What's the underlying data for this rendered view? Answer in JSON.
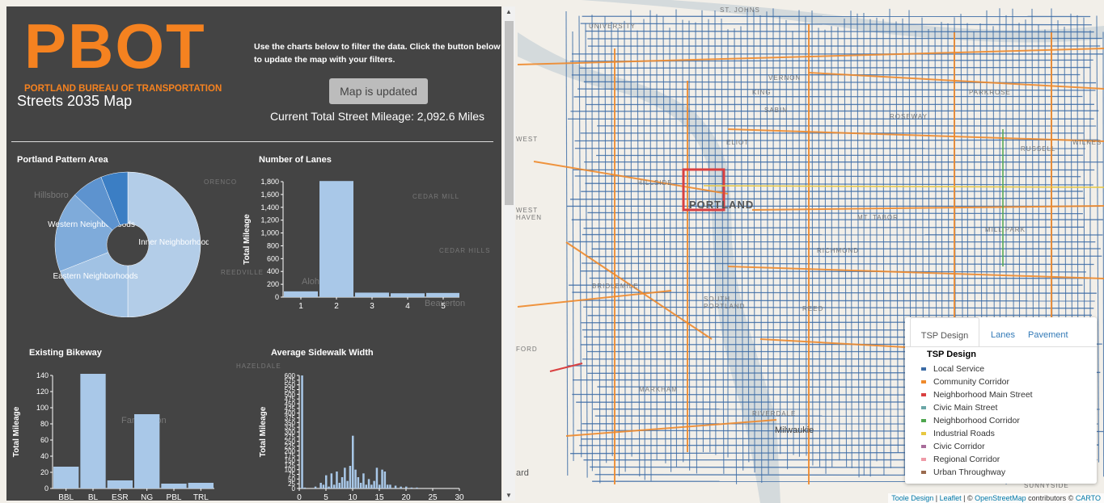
{
  "logo": {
    "text": "PBOT",
    "subtitle": "PORTLAND BUREAU OF TRANSPORTATION"
  },
  "panel": {
    "map_title": "Streets 2035 Map",
    "instructions": "Use the charts below to filter the data. Click the button below to update the map with your filters.",
    "update_button": "Map is updated",
    "mileage": "Current Total Street Mileage: 2,092.6 Miles"
  },
  "chart_data": [
    {
      "type": "pie",
      "title": "Portland Pattern Area",
      "slices": [
        {
          "label": "Inner Neighborhoods",
          "value": 50,
          "color": "#b3cde8"
        },
        {
          "label": "Eastern Neighborhoods",
          "value": 19,
          "color": "#a1c2e4"
        },
        {
          "label": "Western Neighborhoods",
          "value": 18,
          "color": "#7fabda"
        },
        {
          "label": "",
          "value": 7,
          "color": "#5d93cf"
        },
        {
          "label": "",
          "value": 6,
          "color": "#3b7ec4"
        }
      ]
    },
    {
      "type": "bar",
      "title": "Number of Lanes",
      "ylabel": "Total Mileage",
      "categories": [
        "1",
        "2",
        "3",
        "4",
        "5"
      ],
      "values": [
        90,
        1810,
        70,
        60,
        65
      ],
      "ylim": [
        0,
        1800
      ],
      "yticks": [
        0,
        200,
        400,
        600,
        800,
        1000,
        1200,
        1400,
        1600,
        1800
      ],
      "ytick_labels": [
        "0",
        "200",
        "400",
        "600",
        "800",
        "1,000",
        "1,200",
        "1,400",
        "1,600",
        "1,800"
      ]
    },
    {
      "type": "bar",
      "title": "Existing Bikeway",
      "ylabel": "Total Mileage",
      "categories": [
        "BBL",
        "BL",
        "ESR",
        "NG",
        "PBL",
        "TRL"
      ],
      "values": [
        27,
        142,
        10,
        92,
        6,
        7
      ],
      "ylim": [
        0,
        140
      ],
      "yticks": [
        0,
        20,
        40,
        60,
        80,
        100,
        120,
        140
      ]
    },
    {
      "type": "bar",
      "title": "Average Sidewalk Width",
      "ylabel": "Total Mileage",
      "xlim": [
        0,
        30
      ],
      "xticks": [
        0,
        5,
        10,
        15,
        20,
        25,
        30
      ],
      "ylim": [
        0,
        600
      ],
      "yticks": [
        0,
        25,
        50,
        75,
        100,
        125,
        150,
        175,
        200,
        225,
        250,
        275,
        300,
        325,
        350,
        375,
        400,
        425,
        450,
        475,
        500,
        525,
        550,
        575,
        600
      ],
      "x": [
        0.5,
        1,
        3,
        4,
        4.5,
        5,
        5.5,
        6,
        6.5,
        7,
        7.5,
        8,
        8.5,
        9,
        9.5,
        10,
        10.5,
        11,
        11.5,
        12,
        12.5,
        13,
        13.5,
        14,
        14.5,
        15,
        15.5,
        16,
        16.5,
        17,
        18,
        19,
        20,
        21,
        22
      ],
      "values": [
        600,
        5,
        10,
        30,
        20,
        70,
        10,
        80,
        20,
        90,
        30,
        60,
        110,
        40,
        120,
        280,
        100,
        60,
        30,
        80,
        20,
        50,
        20,
        40,
        110,
        20,
        100,
        90,
        20,
        20,
        15,
        10,
        10,
        5,
        5
      ]
    }
  ],
  "legend": {
    "tabs": [
      "TSP Design",
      "Lanes",
      "Pavement"
    ],
    "title": "TSP Design",
    "items": [
      {
        "label": "Local Service",
        "color": "#3b6ba5"
      },
      {
        "label": "Community Corridor",
        "color": "#ef8a2c"
      },
      {
        "label": "Neighborhood Main Street",
        "color": "#d94040"
      },
      {
        "label": "Civic Main Street",
        "color": "#6aa6a6"
      },
      {
        "label": "Neighborhood Corridor",
        "color": "#4ea64e"
      },
      {
        "label": "Industrial Roads",
        "color": "#e8c840"
      },
      {
        "label": "Civic Corridor",
        "color": "#a86c9a"
      },
      {
        "label": "Regional Corridor",
        "color": "#ef9aa6"
      },
      {
        "label": "Urban Throughway",
        "color": "#9a6a4e"
      }
    ]
  },
  "map_labels": [
    "UNIVERSITY",
    "ST. JOHNS",
    "VERNON",
    "PARKROSE",
    "ROSEWAY",
    "KING",
    "SABIN",
    "WEST",
    "ELIOT",
    "RUSSELL",
    "WILKES",
    "HILLSIDE",
    "PORTLAND",
    "WEST HAVEN",
    "MT. TABOR",
    "MILL PARK",
    "RICHMOND",
    "BRIDLEMILE",
    "SOUTH PORTLAND",
    "REED",
    "MARKHAM",
    "RIVERDALE",
    "Milwaukie",
    "SUNNYSIDE",
    "FORD",
    "ard",
    "Hillsboro",
    "ORENCO",
    "CEDAR MILL",
    "CEDAR HILLS",
    "REEDVILLE",
    "Aloha",
    "Beaverton",
    "HAZELDALE",
    "Farmington"
  ],
  "attribution": {
    "toole": "Toole Design",
    "leaflet": "Leaflet",
    "sep": " | © ",
    "osm": "OpenStreetMap",
    "contrib": " contributors © ",
    "carto": "CARTO"
  }
}
